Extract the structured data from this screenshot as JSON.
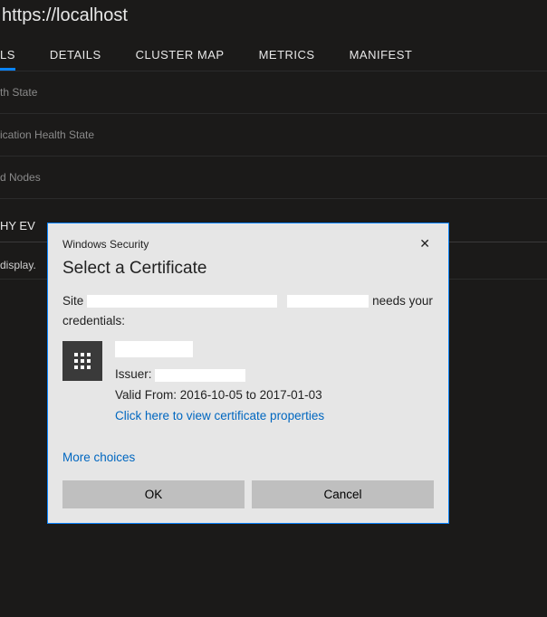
{
  "url": "https://localhost",
  "tabs": [
    "LS",
    "DETAILS",
    "CLUSTER MAP",
    "METRICS",
    "MANIFEST"
  ],
  "activeTab": 0,
  "items": [
    "th State",
    "ication Health State",
    "d Nodes"
  ],
  "section": {
    "title": "HY EV",
    "sub": "display."
  },
  "dialog": {
    "header": "Windows Security",
    "title": "Select a Certificate",
    "msg_prefix": "Site",
    "msg_suffix": "needs your credentials:",
    "issuer_label": "Issuer:",
    "valid_label": "Valid From: 2016-10-05 to 2017-01-03",
    "props_link": "Click here to view certificate properties",
    "more_choices": "More choices",
    "ok": "OK",
    "cancel": "Cancel"
  }
}
